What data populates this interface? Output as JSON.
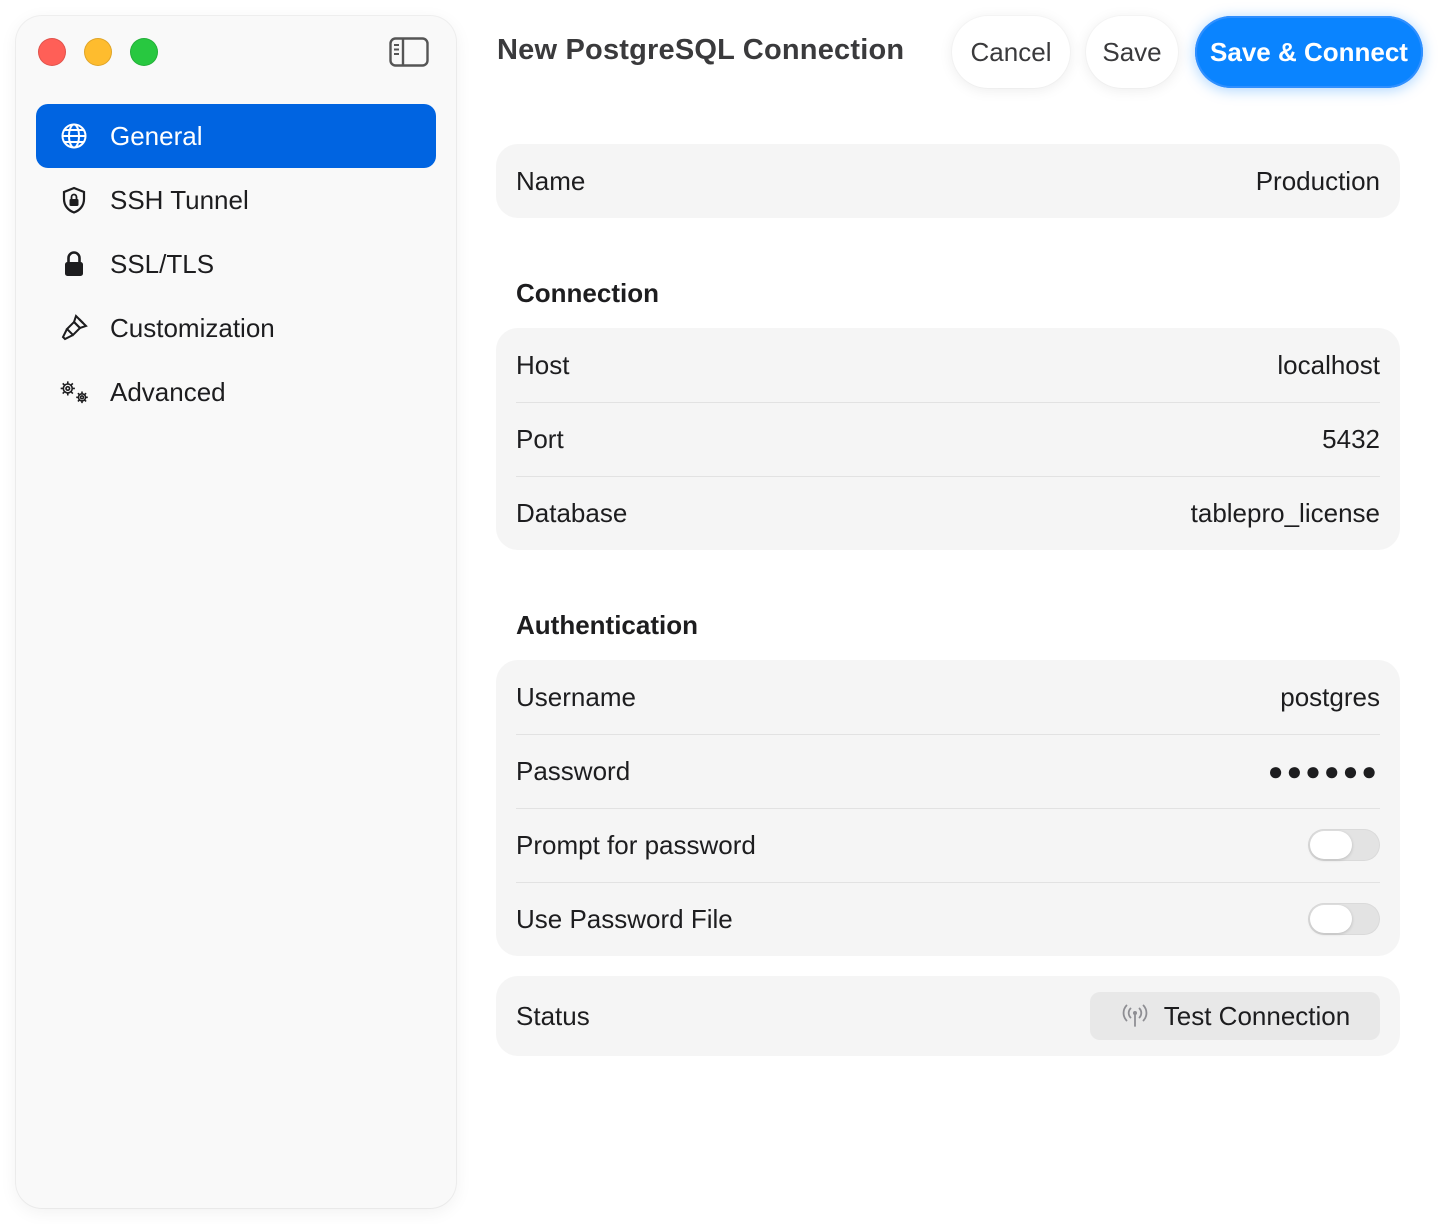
{
  "window": {
    "title": "New PostgreSQL Connection",
    "colors": {
      "accent": "#0a84ff",
      "sidebar_active": "#0064e1",
      "close": "#ff5f57",
      "minimize": "#febc2e",
      "zoom": "#28c840"
    }
  },
  "toolbar": {
    "cancel_label": "Cancel",
    "save_label": "Save",
    "save_connect_label": "Save & Connect"
  },
  "sidebar": {
    "toggle_icon": "sidebar-toggle-icon",
    "items": [
      {
        "label": "General",
        "icon": "globe-icon",
        "active": true
      },
      {
        "label": "SSH Tunnel",
        "icon": "shield-lock-icon",
        "active": false
      },
      {
        "label": "SSL/TLS",
        "icon": "lock-icon",
        "active": false
      },
      {
        "label": "Customization",
        "icon": "paintbrush-icon",
        "active": false
      },
      {
        "label": "Advanced",
        "icon": "gears-icon",
        "active": false
      }
    ]
  },
  "form": {
    "name": {
      "label": "Name",
      "value": "Production"
    },
    "connection": {
      "section_title": "Connection",
      "host": {
        "label": "Host",
        "value": "localhost"
      },
      "port": {
        "label": "Port",
        "value": "5432"
      },
      "database": {
        "label": "Database",
        "value": "tablepro_license"
      }
    },
    "authentication": {
      "section_title": "Authentication",
      "username": {
        "label": "Username",
        "value": "postgres"
      },
      "password": {
        "label": "Password",
        "value": "●●●●●●"
      },
      "prompt_for_password": {
        "label": "Prompt for password",
        "enabled": false
      },
      "use_password_file": {
        "label": "Use Password File",
        "enabled": false
      }
    },
    "status": {
      "label": "Status",
      "test_button_label": "Test Connection",
      "test_icon": "antenna-icon"
    }
  }
}
